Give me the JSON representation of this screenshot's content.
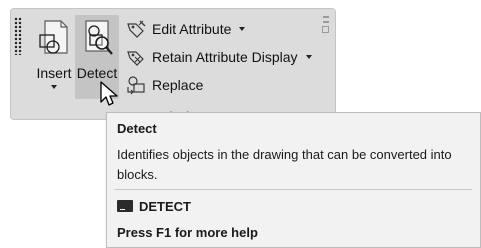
{
  "ribbon": {
    "insert_label": "Insert",
    "detect_label": "Detect",
    "small_buttons": [
      {
        "label": "Edit Attribute",
        "icon": "edit-attribute-icon",
        "has_dropdown": true
      },
      {
        "label": "Retain Attribute Display",
        "icon": "retain-attribute-display-icon",
        "has_dropdown": true
      },
      {
        "label": "Replace",
        "icon": "replace-icon",
        "has_dropdown": false
      }
    ],
    "panel_title_partial": "Block"
  },
  "tooltip": {
    "title": "Detect",
    "description": "Identifies objects in the drawing that can be converted into blocks.",
    "command": "DETECT",
    "help": "Press F1 for more help"
  },
  "colors": {
    "ribbon_bg": "#dcdcdc",
    "hover_bg": "#c4c4c4",
    "tooltip_bg": "#f2f2f2",
    "text": "#111111"
  }
}
